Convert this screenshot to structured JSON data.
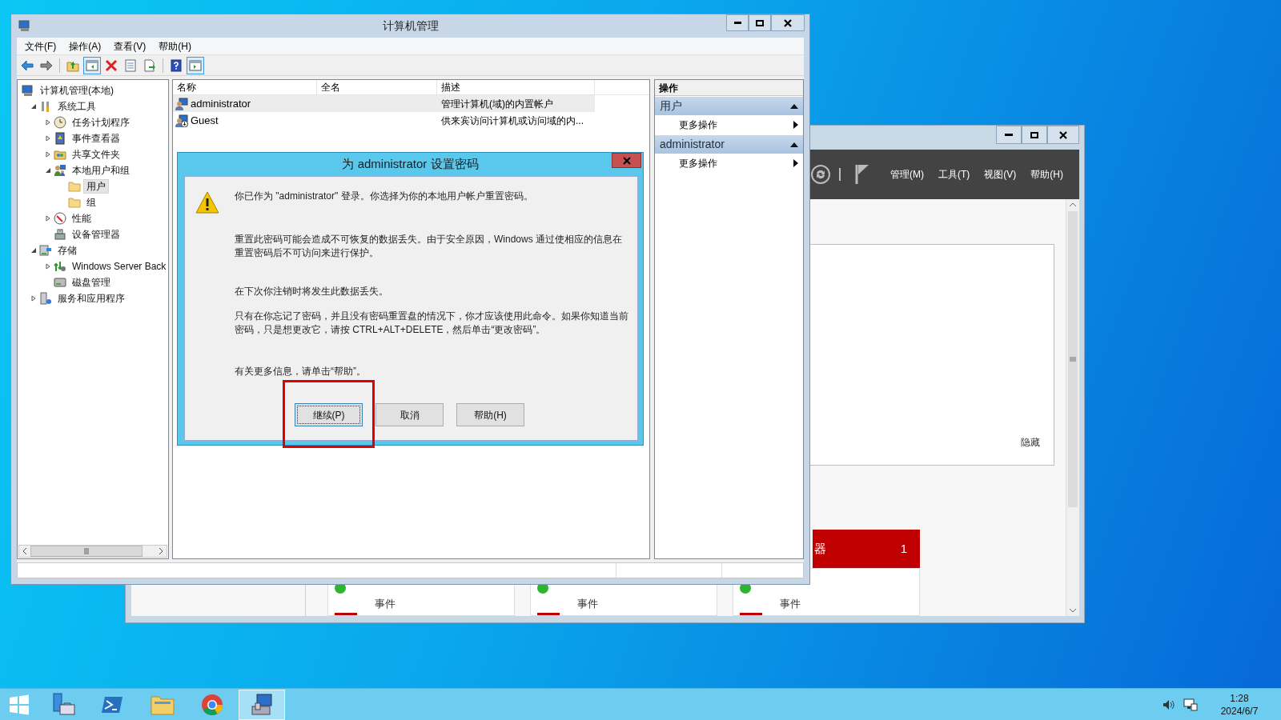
{
  "server_manager": {
    "menu": [
      "管理(M)",
      "工具(T)",
      "视图(V)",
      "帮助(H)"
    ],
    "card_link": "隐藏",
    "tiles": [
      {
        "label": "事件"
      },
      {
        "label": "事件"
      },
      {
        "title": "器",
        "count": "1",
        "label": "事件"
      }
    ]
  },
  "main_window": {
    "title": "计算机管理",
    "menu": [
      "文件(F)",
      "操作(A)",
      "查看(V)",
      "帮助(H)"
    ],
    "toolbar": [
      {
        "kind": "back",
        "pressed": false
      },
      {
        "kind": "forward",
        "pressed": false
      },
      {
        "kind": "separator"
      },
      {
        "kind": "up",
        "pressed": false
      },
      {
        "kind": "tree_toggle",
        "pressed": true
      },
      {
        "kind": "delete",
        "pressed": false
      },
      {
        "kind": "properties",
        "pressed": false
      },
      {
        "kind": "export",
        "pressed": false
      },
      {
        "kind": "separator"
      },
      {
        "kind": "help",
        "pressed": false
      },
      {
        "kind": "pane_toggle",
        "pressed": true
      }
    ],
    "tree": [
      {
        "label": "计算机管理(本地)",
        "kind": "computer",
        "selected": false,
        "children": [
          {
            "label": "系统工具",
            "kind": "tools",
            "expanded": true,
            "selected": false,
            "children": [
              {
                "label": "任务计划程序",
                "kind": "clock",
                "expanded": false,
                "selected": false
              },
              {
                "label": "事件查看器",
                "kind": "event",
                "expanded": false,
                "selected": false
              },
              {
                "label": "共享文件夹",
                "kind": "share",
                "expanded": false,
                "selected": false
              },
              {
                "label": "本地用户和组",
                "kind": "users",
                "expanded": true,
                "selected": false,
                "children": [
                  {
                    "label": "用户",
                    "kind": "folder",
                    "selected": true
                  },
                  {
                    "label": "组",
                    "kind": "folder",
                    "selected": false
                  }
                ]
              },
              {
                "label": "性能",
                "kind": "perf",
                "expanded": false,
                "selected": false
              },
              {
                "label": "设备管理器",
                "kind": "device",
                "selected": false
              }
            ]
          },
          {
            "label": "存储",
            "kind": "storage",
            "expanded": true,
            "selected": false,
            "children": [
              {
                "label": "Windows Server Back",
                "kind": "backup",
                "expanded": false,
                "selected": false
              },
              {
                "label": "磁盘管理",
                "kind": "disk",
                "selected": false
              }
            ]
          },
          {
            "label": "服务和应用程序",
            "kind": "services",
            "expanded": false,
            "selected": false
          }
        ]
      }
    ],
    "list": {
      "columns": [
        "名称",
        "全名",
        "描述"
      ],
      "rows": [
        {
          "name": "administrator",
          "description": "管理计算机(域)的内置帐户",
          "selected": true,
          "disabled": false
        },
        {
          "name": "Guest",
          "description": "供来宾访问计算机或访问域的内...",
          "selected": false,
          "disabled": true
        }
      ]
    },
    "actions": {
      "header": "操作",
      "sections": [
        {
          "title": "用户",
          "expanded": true,
          "items": [
            "更多操作"
          ]
        },
        {
          "title": "administrator",
          "expanded": true,
          "items": [
            "更多操作"
          ]
        }
      ]
    }
  },
  "dialog": {
    "title": "为 administrator 设置密码",
    "paragraphs": [
      "你已作为 \"administrator\" 登录。你选择为你的本地用户帐户重置密码。",
      "重置此密码可能会造成不可恢复的数据丢失。由于安全原因，Windows 通过使相应的信息在重置密码后不可访问来进行保护。",
      "在下次你注销时将发生此数据丢失。",
      "只有在你忘记了密码，并且没有密码重置盘的情况下，你才应该使用此命令。如果你知道当前密码，只是想更改它，请按 CTRL+ALT+DELETE，然后单击“更改密码”。",
      "有关更多信息，请单击“帮助”。"
    ],
    "buttons": [
      {
        "label": "继续(P)",
        "focused": true,
        "highlighted": true
      },
      {
        "label": "取消",
        "focused": false,
        "highlighted": false
      },
      {
        "label": "帮助(H)",
        "focused": false,
        "highlighted": false
      }
    ]
  },
  "taskbar": {
    "items": [
      {
        "kind": "server_manager",
        "selected": false
      },
      {
        "kind": "powershell",
        "selected": false
      },
      {
        "kind": "explorer",
        "selected": false
      },
      {
        "kind": "browser",
        "selected": false
      },
      {
        "kind": "computer_management",
        "selected": true
      }
    ],
    "time": "1:28",
    "date": "2024/6/7"
  }
}
